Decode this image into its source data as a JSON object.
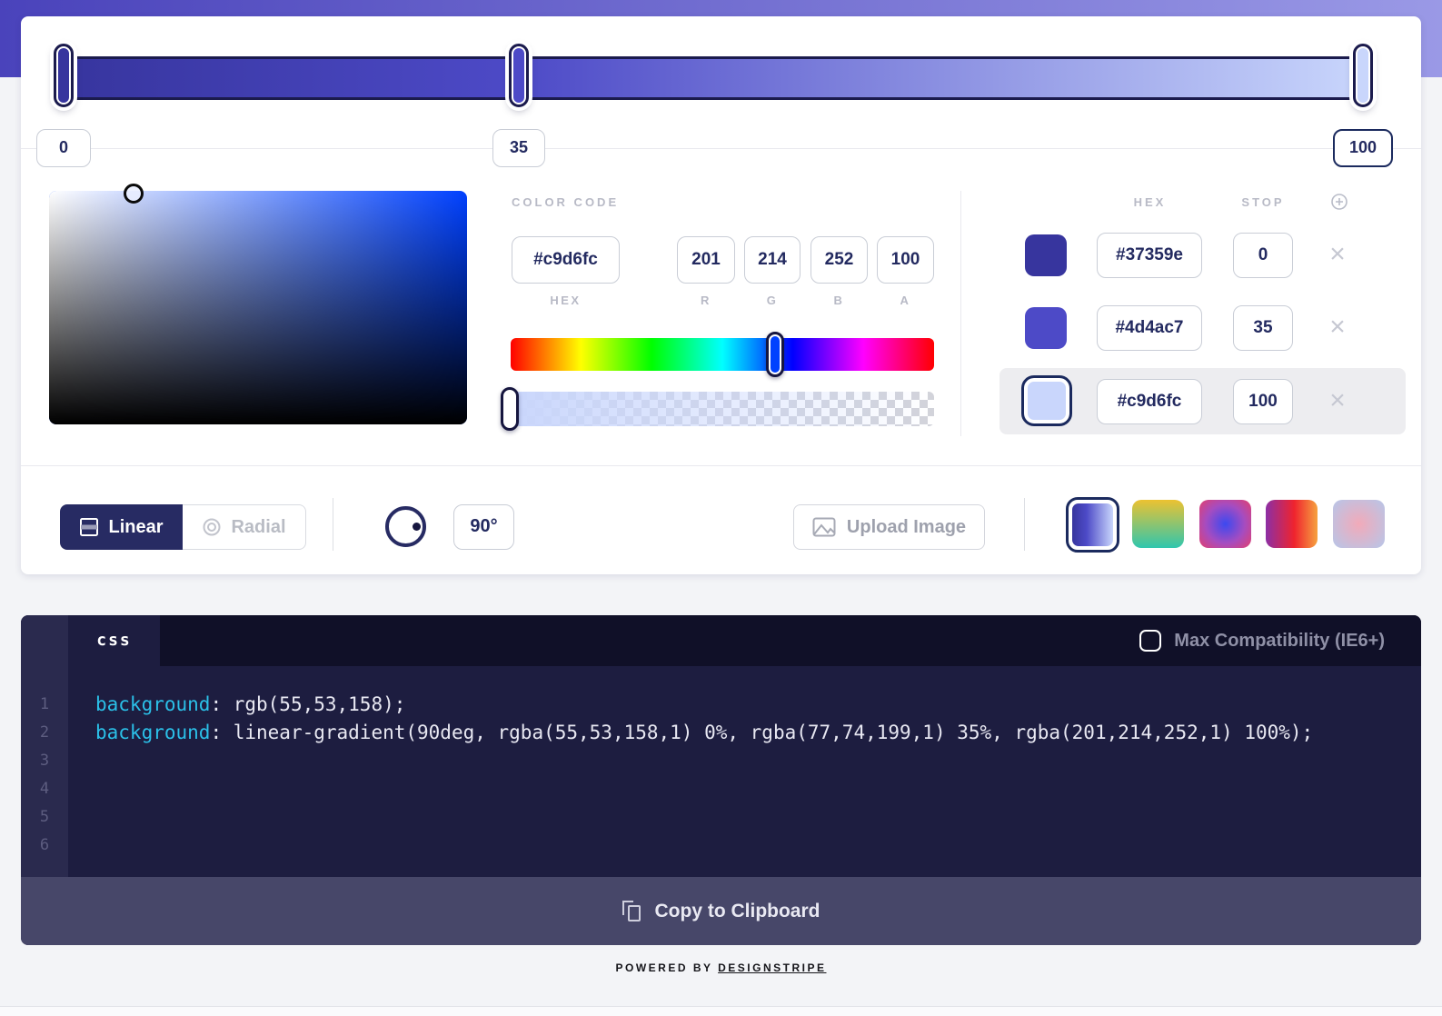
{
  "header": {
    "band_gradient": "linear-gradient(90deg, #4a43bb 0%, #9a99e6 100%)"
  },
  "gradient_editor": {
    "bar_gradient": "linear-gradient(90deg, #37359e 0%, #4d4ac7 35%, #c9d6fc 100%)",
    "stops": [
      {
        "hex": "#37359e",
        "stop": "0",
        "position_pct": 0
      },
      {
        "hex": "#4d4ac7",
        "stop": "35",
        "position_pct": 35
      },
      {
        "hex": "#c9d6fc",
        "stop": "100",
        "position_pct": 100
      }
    ],
    "selected_stop_index": 2
  },
  "color_picker": {
    "section_label": "COLOR CODE",
    "hue_color": "#0041ff",
    "hex": {
      "value": "#c9d6fc",
      "label": "HEX"
    },
    "r": {
      "value": "201",
      "label": "R"
    },
    "g": {
      "value": "214",
      "label": "G"
    },
    "b": {
      "value": "252",
      "label": "B"
    },
    "a": {
      "value": "100",
      "label": "A"
    },
    "alpha_overlay": "linear-gradient(90deg, #c9d6fc 0%, rgba(201,214,252,0) 100%)"
  },
  "stops_panel": {
    "hex_header": "HEX",
    "stop_header": "STOP",
    "rows": [
      {
        "swatch": "#37359e",
        "hex": "#37359e",
        "stop": "0",
        "delete": "×"
      },
      {
        "swatch": "#4d4ac7",
        "hex": "#4d4ac7",
        "stop": "35",
        "delete": "×"
      },
      {
        "swatch": "#c9d6fc",
        "hex": "#c9d6fc",
        "stop": "100",
        "delete": "×"
      }
    ],
    "selected_row_index": 2
  },
  "toolbar": {
    "linear_label": "Linear",
    "radial_label": "Radial",
    "angle_value": "90°",
    "upload_label": "Upload Image",
    "presets": [
      {
        "css": "linear-gradient(90deg, #37359e 0%, #4d4ac7 35%, #c9d6fc 100%)",
        "selected": true
      },
      {
        "css": "linear-gradient(180deg, #ecc231 0%, #2fc6ae 100%)",
        "selected": false
      },
      {
        "css": "radial-gradient(circle, #3c49f0 0%, #a64cc0 55%, #e2406e 100%)",
        "selected": false
      },
      {
        "css": "linear-gradient(90deg, #8c2fa5 0%, #ef232e 55%, #f6a23f 100%)",
        "selected": false
      },
      {
        "css": "radial-gradient(circle, #f2aab9 0%, #b6c6e9 100%)",
        "selected": false
      }
    ]
  },
  "code_panel": {
    "tab_label": "css",
    "compat_label": "Max Compatibility (IE6+)",
    "compat_checked": false,
    "line_numbers": [
      "1",
      "2",
      "3",
      "4",
      "5",
      "6"
    ],
    "lines": [
      {
        "property": "background",
        "rest": ": rgb(55,53,158);"
      },
      {
        "property": "background",
        "rest": ": linear-gradient(90deg, rgba(55,53,158,1) 0%, rgba(77,74,199,1) 35%, rgba(201,214,252,1) 100%);"
      }
    ],
    "copy_label": "Copy to Clipboard"
  },
  "footer": {
    "powered_by": "POWERED BY ",
    "brand": "DESIGNSTRIPE"
  }
}
